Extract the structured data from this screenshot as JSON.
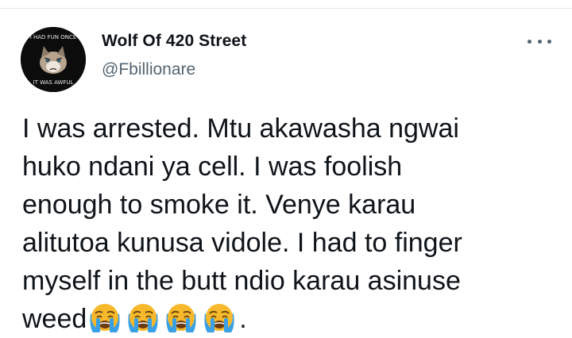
{
  "tweet": {
    "author": {
      "display_name": "Wolf Of 420 Street",
      "handle": "@Fbillionare",
      "avatar_top_text": "I HAD FUN ONCE",
      "avatar_bottom_text": "IT WAS AWFUL"
    },
    "more_icon": "more-horizontal-icon",
    "body_lines": [
      "I was arrested. Mtu akawasha ngwai",
      "huko ndani ya cell. I was foolish",
      "enough to smoke it. Venye karau",
      "alitutoa kunusa vidole. I had to finger",
      "myself in the butt ndio karau asinuse"
    ],
    "last_line_text": "weed",
    "emojis": [
      "loudly-crying-face-icon",
      "loudly-crying-face-icon",
      "loudly-crying-face-icon",
      "loudly-crying-face-icon"
    ],
    "trailing_text": "."
  },
  "colors": {
    "name": "#0f1419",
    "handle": "#536471",
    "divider": "#e3e6e8",
    "emoji_face": "#f7b92b",
    "emoji_tears": "#3aa0e6"
  }
}
